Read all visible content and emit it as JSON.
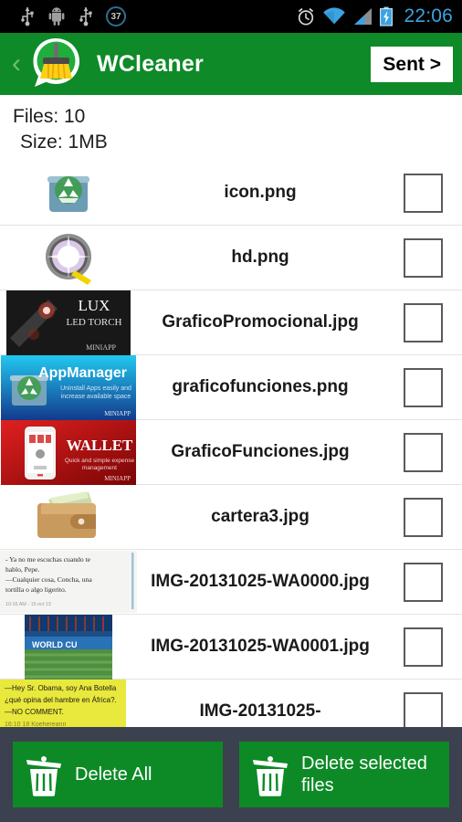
{
  "status_bar": {
    "icons": [
      "usb-icon",
      "android-debug-icon",
      "usb-icon",
      "notification-count-badge"
    ],
    "notification_count": "37",
    "right_icons": [
      "alarm-icon",
      "wifi-icon",
      "signal-icon",
      "battery-charging-icon"
    ],
    "time": "22:06"
  },
  "header": {
    "back_label": "‹",
    "logo_name": "wcleaner-logo",
    "title": "WCleaner",
    "sent_button": "Sent >"
  },
  "summary": {
    "files_label": "Files: 10",
    "size_label": "Size: 1MB"
  },
  "files": [
    {
      "name": "icon.png",
      "thumb": "recycle-bin-icon"
    },
    {
      "name": "hd.png",
      "thumb": "camera-flash-icon"
    },
    {
      "name": "GraficoPromocional.jpg",
      "thumb": "lux-led-torch-banner"
    },
    {
      "name": "graficofunciones.png",
      "thumb": "appmanager-banner"
    },
    {
      "name": "GraficoFunciones.jpg",
      "thumb": "wallet-banner"
    },
    {
      "name": "cartera3.jpg",
      "thumb": "wallet-photo"
    },
    {
      "name": "IMG-20131025-WA0000.jpg",
      "thumb": "text-screenshot"
    },
    {
      "name": "IMG-20131025-WA0001.jpg",
      "thumb": "stadium-photo"
    },
    {
      "name": "IMG-20131025-",
      "thumb": "yellow-meme"
    }
  ],
  "thumb_text": {
    "lux_title": "LUX",
    "lux_sub": "LED TORCH",
    "lux_brand": "MINIAPP",
    "appmanager_title": "AppManager",
    "appmanager_sub": "Uninstall Apps easily and\nincrease available space",
    "wallet_title": "WALLET",
    "wallet_sub": "Quick and simple expense\nmanagement",
    "screenshot_l1": "- Ya no me escuchas cuando te",
    "screenshot_l2": "hablo, Pepe.",
    "screenshot_l3": "—Cualquier cosa, Concha, una",
    "screenshot_l4": "tortilla o algo ligerito.",
    "stadium_text": "WORLD  CU",
    "meme_l1": "—Hey Sr. Obama, soy Ana Botella",
    "meme_l2": "¿qué opina del hambre en África?.",
    "meme_l3": "—NO COMMENT."
  },
  "actions": {
    "delete_all": "Delete All",
    "delete_selected": "Delete selected files"
  },
  "colors": {
    "brand_green": "#0e8a28",
    "button_green": "#0d8a26",
    "action_bar": "#3c4150",
    "status_bar": "#000000",
    "clock_blue": "#3ba3e0"
  }
}
